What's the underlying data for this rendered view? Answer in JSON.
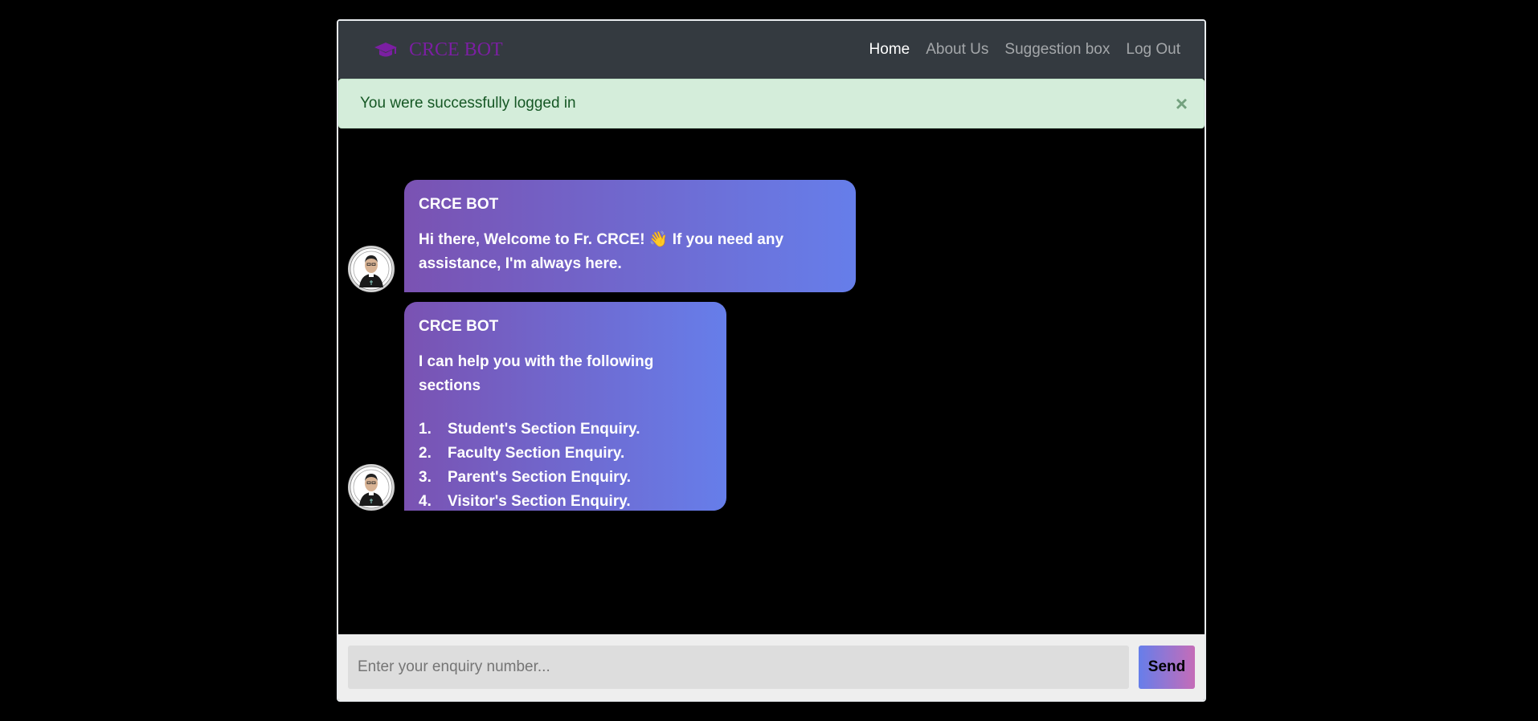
{
  "navbar": {
    "brand": "CRCE BOT",
    "brand_icon": "graduation-cap-icon",
    "links": [
      {
        "label": "Home",
        "active": true
      },
      {
        "label": "About Us",
        "active": false
      },
      {
        "label": "Suggestion box",
        "active": false
      },
      {
        "label": "Log Out",
        "active": false
      }
    ]
  },
  "alert": {
    "message": "You were successfully logged in",
    "close": "×"
  },
  "messages": [
    {
      "sender": "CRCE BOT",
      "text": "Hi there, Welcome to Fr. CRCE! 👋 If you need any assistance, I'm always here."
    },
    {
      "sender": "CRCE BOT",
      "text": "I can help you with the following sections",
      "list": [
        {
          "num": "1.",
          "label": "Student's Section Enquiry."
        },
        {
          "num": "2.",
          "label": "Faculty Section Enquiry."
        },
        {
          "num": "3.",
          "label": "Parent's Section Enquiry."
        },
        {
          "num": "4.",
          "label": "Visitor's Section Enquiry."
        }
      ]
    }
  ],
  "composer": {
    "placeholder": "Enter your enquiry number...",
    "send_label": "Send"
  },
  "colors": {
    "brand": "#7b1fa2",
    "bubble_start": "#7a52b2",
    "bubble_end": "#667eea",
    "alert_bg": "#d4edda",
    "alert_text": "#155724"
  }
}
